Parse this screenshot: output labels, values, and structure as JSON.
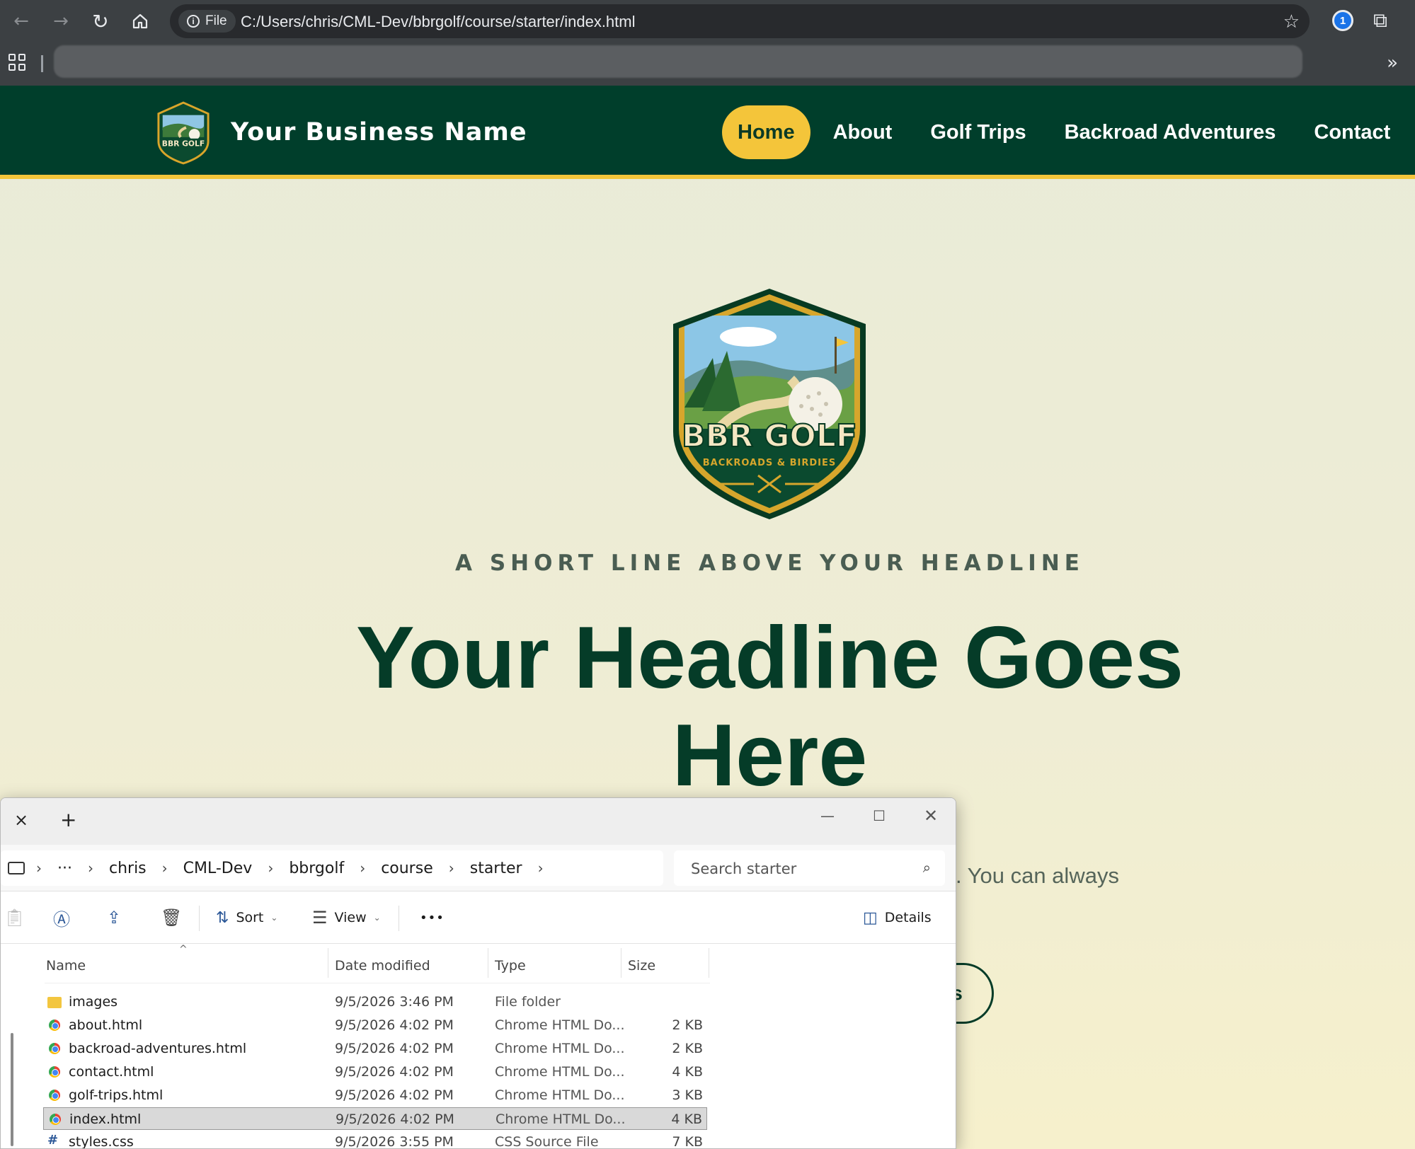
{
  "browser": {
    "omnibox_chip": "File",
    "url": "C:/Users/chris/CML-Dev/bbrgolf/course/starter/index.html"
  },
  "site": {
    "business_name": "Your Business Name",
    "nav": [
      "Home",
      "About",
      "Golf Trips",
      "Backroad Adventures",
      "Contact"
    ],
    "active_nav": "Home",
    "logo": {
      "title": "BBR GOLF",
      "tagline": "BACKROADS & BIRDIES"
    },
    "eyebrow": "A SHORT LINE ABOVE YOUR HEADLINE",
    "headline": "Your Headline Goes Here",
    "subtext_fragment": ". You can always",
    "cta_fragment": "s",
    "colors": {
      "header": "#003e2b",
      "accent": "#f4c53a",
      "headline": "#053c28"
    }
  },
  "explorer": {
    "tab_close": "×",
    "new_tab": "+",
    "breadcrumb": [
      "chris",
      "CML-Dev",
      "bbrgolf",
      "course",
      "starter"
    ],
    "breadcrumb_more": "···",
    "search_placeholder": "Search starter",
    "commands": {
      "sort": "Sort",
      "view": "View",
      "more": "•••",
      "details": "Details"
    },
    "columns": {
      "name": "Name",
      "date": "Date modified",
      "type": "Type",
      "size": "Size"
    },
    "files": [
      {
        "name": "images",
        "date": "9/5/2026 3:46 PM",
        "type": "File folder",
        "size": "",
        "icon": "folder-icon"
      },
      {
        "name": "about.html",
        "date": "9/5/2026 4:02 PM",
        "type": "Chrome HTML Do...",
        "size": "2 KB",
        "icon": "chrome-html-icon"
      },
      {
        "name": "backroad-adventures.html",
        "date": "9/5/2026 4:02 PM",
        "type": "Chrome HTML Do...",
        "size": "2 KB",
        "icon": "chrome-html-icon"
      },
      {
        "name": "contact.html",
        "date": "9/5/2026 4:02 PM",
        "type": "Chrome HTML Do...",
        "size": "4 KB",
        "icon": "chrome-html-icon"
      },
      {
        "name": "golf-trips.html",
        "date": "9/5/2026 4:02 PM",
        "type": "Chrome HTML Do...",
        "size": "3 KB",
        "icon": "chrome-html-icon"
      },
      {
        "name": "index.html",
        "date": "9/5/2026 4:02 PM",
        "type": "Chrome HTML Do...",
        "size": "4 KB",
        "icon": "chrome-html-icon",
        "selected": true
      },
      {
        "name": "styles.css",
        "date": "9/5/2026 3:55 PM",
        "type": "CSS Source File",
        "size": "7 KB",
        "icon": "css-file-icon"
      }
    ]
  }
}
